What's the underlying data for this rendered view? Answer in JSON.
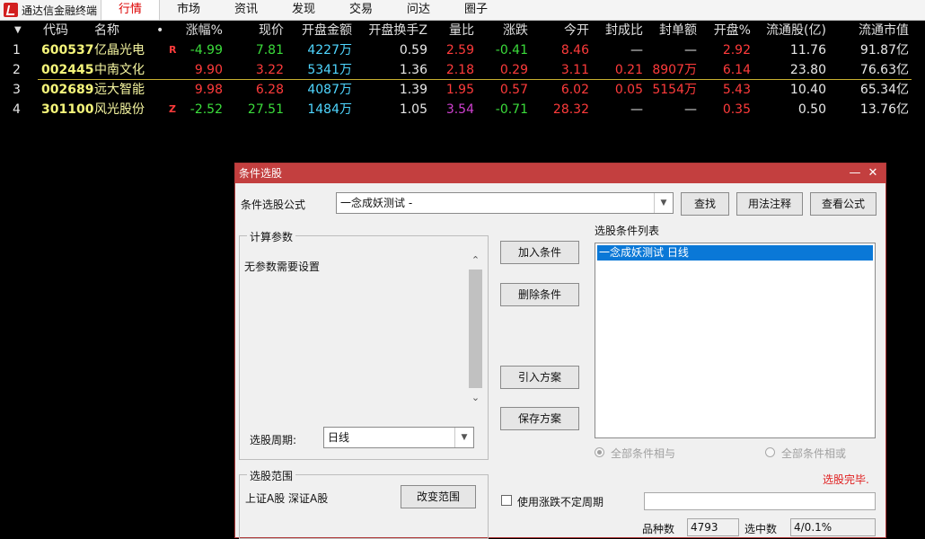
{
  "menubar": {
    "app_title": "通达信金融终端",
    "tabs": [
      "行情",
      "市场",
      "资讯",
      "发现",
      "交易",
      "问达",
      "圈子"
    ],
    "active_tab": 0
  },
  "quote_table": {
    "headers": [
      "代码",
      "名称",
      "•",
      "涨幅%",
      "现价",
      "开盘金额",
      "开盘换手Z",
      "量比",
      "涨跌",
      "今开",
      "封成比",
      "封单额",
      "开盘%",
      "流通股(亿)",
      "流通市值"
    ],
    "rows": [
      {
        "idx": "1",
        "code": "600537",
        "name": "亿晶光电",
        "flag": "R",
        "change_pct": "-4.99",
        "price": "7.81",
        "open_amount": "4227万",
        "open_turnover": "0.59",
        "vol_ratio": "2.59",
        "change": "-0.41",
        "open": "8.46",
        "seal_ratio": "—",
        "seal_amount": "—",
        "open_pct": "2.92",
        "float_shares": "11.76",
        "float_cap": "91.87亿"
      },
      {
        "idx": "2",
        "code": "002445",
        "name": "中南文化",
        "flag": "",
        "change_pct": "9.90",
        "price": "3.22",
        "open_amount": "5341万",
        "open_turnover": "1.36",
        "vol_ratio": "2.18",
        "change": "0.29",
        "open": "3.11",
        "seal_ratio": "0.21",
        "seal_amount": "8907万",
        "open_pct": "6.14",
        "float_shares": "23.80",
        "float_cap": "76.63亿"
      },
      {
        "idx": "3",
        "code": "002689",
        "name": "远大智能",
        "flag": "",
        "change_pct": "9.98",
        "price": "6.28",
        "open_amount": "4087万",
        "open_turnover": "1.39",
        "vol_ratio": "1.95",
        "change": "0.57",
        "open": "6.02",
        "seal_ratio": "0.05",
        "seal_amount": "5154万",
        "open_pct": "5.43",
        "float_shares": "10.40",
        "float_cap": "65.34亿"
      },
      {
        "idx": "4",
        "code": "301100",
        "name": "风光股份",
        "flag": "Z",
        "change_pct": "-2.52",
        "price": "27.51",
        "open_amount": "1484万",
        "open_turnover": "1.05",
        "vol_ratio": "3.54",
        "change": "-0.71",
        "open": "28.32",
        "seal_ratio": "—",
        "seal_amount": "—",
        "open_pct": "0.35",
        "float_shares": "0.50",
        "float_cap": "13.76亿"
      }
    ]
  },
  "dialog": {
    "title": "条件选股",
    "formula_label": "条件选股公式",
    "formula_value": "一念成妖测试 -",
    "btn_find": "查找",
    "btn_usage": "用法注释",
    "btn_view": "查看公式",
    "calc_group": "计算参数",
    "no_params": "无参数需要设置",
    "period_label": "选股周期:",
    "period_value": "日线",
    "btn_add": "加入条件",
    "btn_delete": "删除条件",
    "btn_import": "引入方案",
    "btn_save": "保存方案",
    "cond_list_label": "选股条件列表",
    "cond_items": [
      "一念成妖测试  日线"
    ],
    "radio_and": "全部条件相与",
    "radio_or": "全部条件相或",
    "status": "选股完毕.",
    "range_group": "选股范围",
    "range_value": "上证A股 深证A股",
    "btn_change_range": "改变范围",
    "chk_label": "使用涨跌不定周期",
    "count_label": "品种数",
    "count_value": "4793",
    "selected_label": "选中数",
    "selected_value": "4/0.1%"
  },
  "colors": {
    "up": "#ff3b3b",
    "down": "#3bdc3b",
    "amount": "#4fd6ff",
    "neutral": "#e8e8e8",
    "purple": "#d040d0",
    "accent": "#c33f3f"
  }
}
